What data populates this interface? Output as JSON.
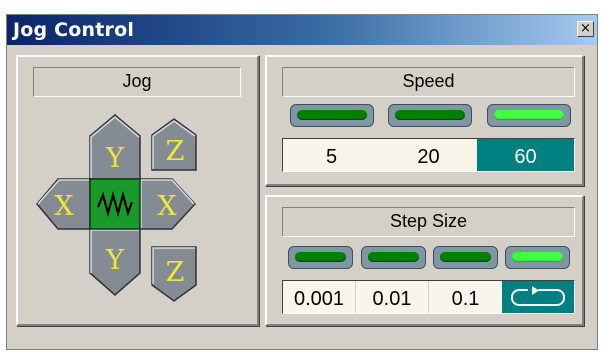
{
  "window": {
    "title": "Jog Control",
    "close_glyph": "×"
  },
  "jog": {
    "label": "Jog",
    "buttons": {
      "y_up": "Y",
      "y_down": "Y",
      "x_left": "X",
      "x_right": "X",
      "z_up": "Z",
      "z_down": "Z"
    },
    "center_icon": "continuous-wave-icon"
  },
  "speed": {
    "label": "Speed",
    "options": [
      "5",
      "20",
      "60"
    ],
    "selected": "60"
  },
  "step_size": {
    "label": "Step Size",
    "options": [
      "0.001",
      "0.01",
      "0.1"
    ],
    "continuous_icon": "continuous-loop-icon",
    "selected": "continuous"
  },
  "colors": {
    "title_start": "#0a246a",
    "selected_bg": "#008080",
    "led_off": "#008000",
    "led_on": "#40ff40",
    "jog_text": "#f0e838",
    "jog_center": "#1a9a2a"
  }
}
